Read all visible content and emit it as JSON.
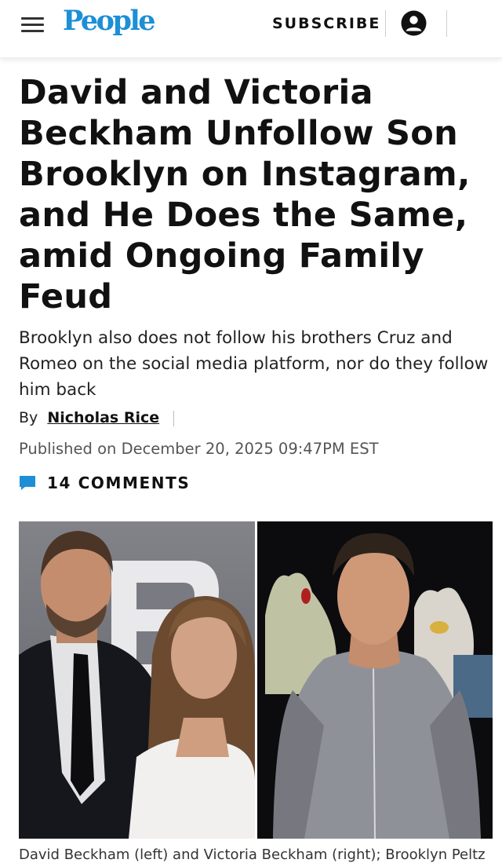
{
  "header": {
    "logo": "People",
    "subscribe_label": "SUBSCRIBE",
    "menu_icon": "hamburger-menu-icon",
    "account_icon": "user-account-icon",
    "brand_color": "#1c8fd6"
  },
  "article": {
    "headline": "David and Victoria Beckham Unfollow Son Brooklyn on Instagram, and He Does the Same, amid Ongoing Family Feud",
    "dek": "Brooklyn also does not follow his brothers Cruz and Romeo on the social media platform, nor do they follow him back",
    "byline_prefix": "By",
    "author": "Nicholas Rice",
    "published": "Published on December 20, 2025 09:47PM EST",
    "comments_label": "14 COMMENTS",
    "comments_icon": "comment-bubble-icon",
    "comments_icon_color": "#1c8fd6",
    "caption": "David Beckham (left) and Victoria Beckham (right); Brooklyn Peltz"
  }
}
